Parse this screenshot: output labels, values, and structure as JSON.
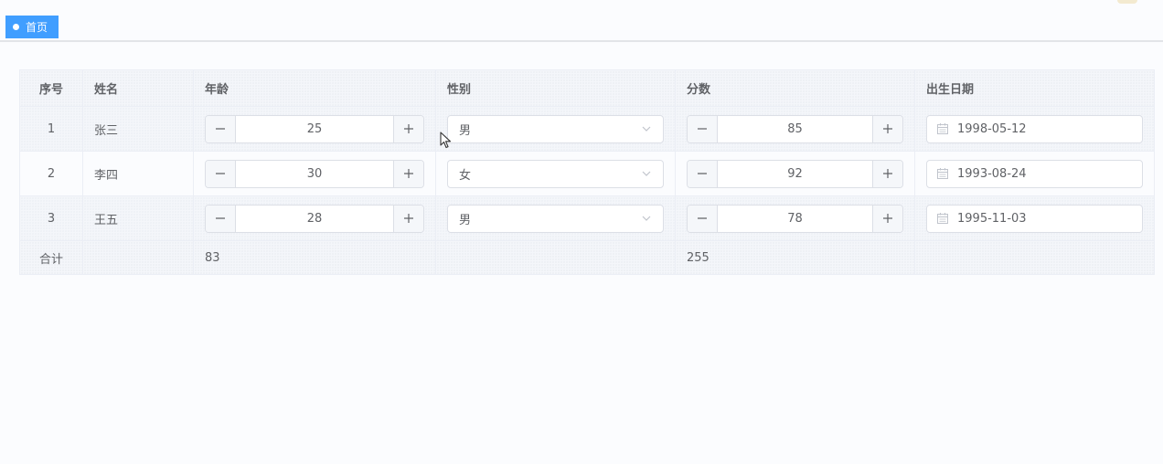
{
  "tabs": [
    {
      "label": "首页",
      "active": true
    }
  ],
  "colors": {
    "accent": "#409eff",
    "border": "#ebeef5",
    "text": "#606266"
  },
  "table": {
    "columns": [
      "序号",
      "姓名",
      "年龄",
      "性别",
      "分数",
      "出生日期"
    ],
    "rows": [
      {
        "index": "1",
        "name": "张三",
        "age": "25",
        "gender": "男",
        "score": "85",
        "birth": "1998-05-12"
      },
      {
        "index": "2",
        "name": "李四",
        "age": "30",
        "gender": "女",
        "score": "92",
        "birth": "1993-08-24"
      },
      {
        "index": "3",
        "name": "王五",
        "age": "28",
        "gender": "男",
        "score": "78",
        "birth": "1995-11-03"
      }
    ],
    "footer": {
      "label": "合计",
      "age_total": "83",
      "score_total": "255"
    }
  },
  "icons": {
    "tag_dot": "dot-icon",
    "stepper_minus": "minus-icon",
    "stepper_plus": "plus-icon",
    "select_arrow": "chevron-down-icon",
    "date": "calendar-icon"
  }
}
